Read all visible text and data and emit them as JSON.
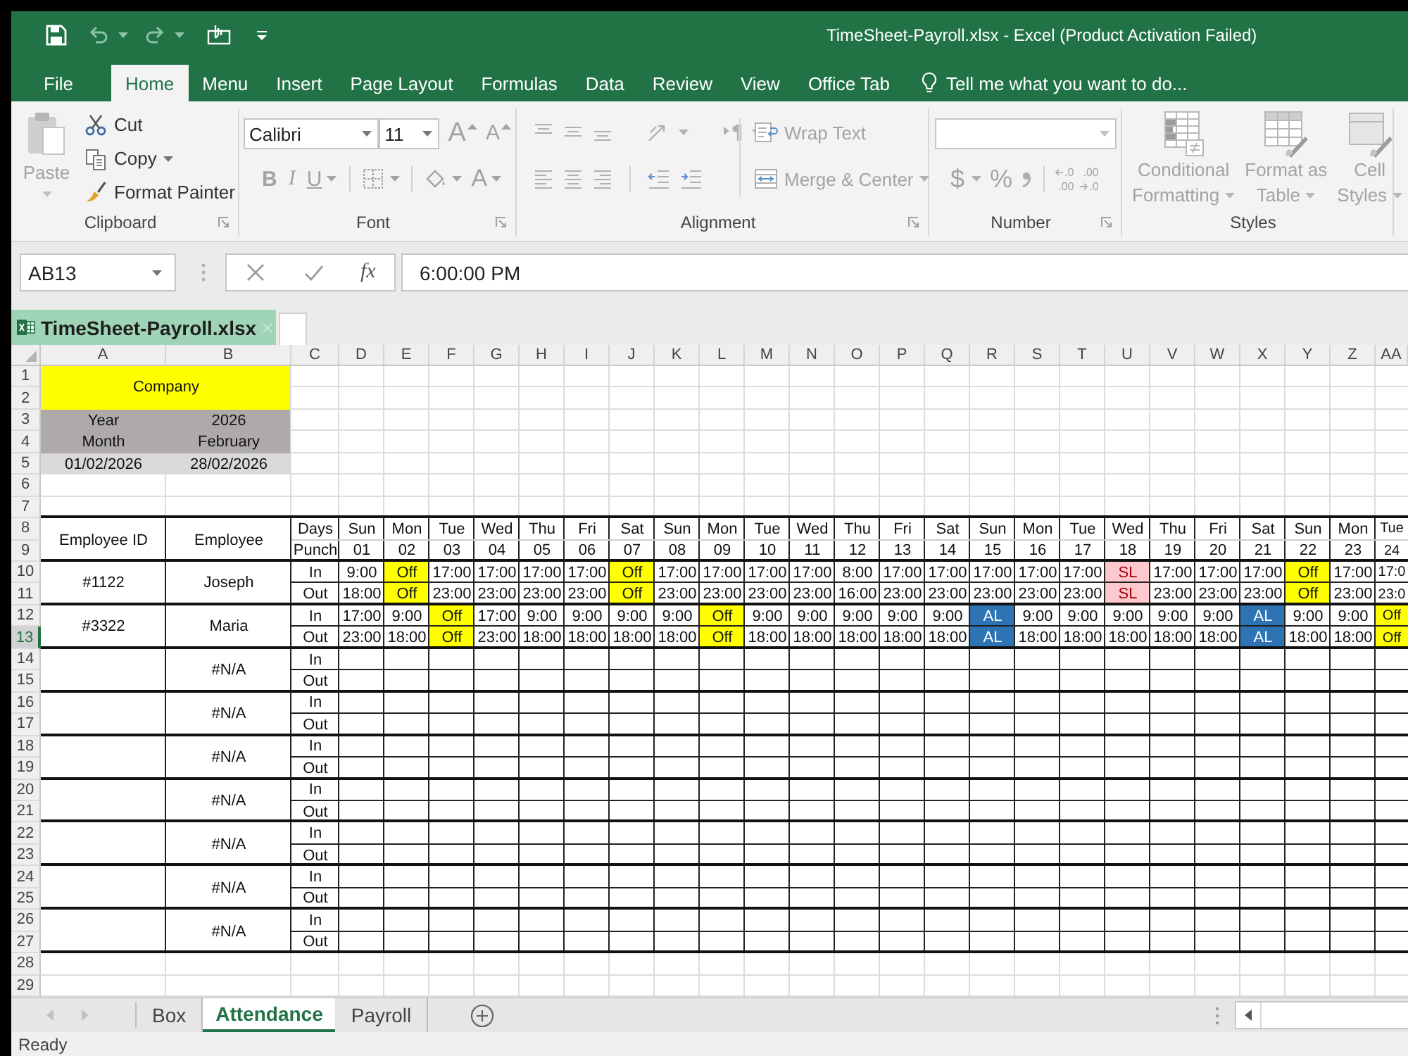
{
  "window": {
    "title": "TimeSheet-Payroll.xlsx - Excel (Product Activation Failed)"
  },
  "menu_tabs": [
    {
      "label": "File",
      "selected": false
    },
    {
      "label": "Home",
      "selected": true
    },
    {
      "label": "Menu",
      "selected": false
    },
    {
      "label": "Insert",
      "selected": false
    },
    {
      "label": "Page Layout",
      "selected": false
    },
    {
      "label": "Formulas",
      "selected": false
    },
    {
      "label": "Data",
      "selected": false
    },
    {
      "label": "Review",
      "selected": false
    },
    {
      "label": "View",
      "selected": false
    },
    {
      "label": "Office Tab",
      "selected": false
    }
  ],
  "tell_me": {
    "placeholder": "Tell me what you want to do..."
  },
  "ribbon": {
    "clipboard": {
      "label": "Clipboard",
      "paste": {
        "label": "Paste",
        "disabled": true
      },
      "actions": [
        {
          "kind": "cut",
          "label": "Cut",
          "disabled": false
        },
        {
          "kind": "copy",
          "label": "Copy",
          "disabled": false
        },
        {
          "kind": "format_painter",
          "label": "Format Painter",
          "disabled": false
        }
      ]
    },
    "font": {
      "label": "Font",
      "font_name": "Calibri",
      "font_size": "11",
      "grow": "A",
      "shrink": "A",
      "styles": [
        {
          "kind": "bold",
          "label": "B"
        },
        {
          "kind": "italic",
          "label": "I"
        },
        {
          "kind": "underline",
          "label": "U"
        }
      ],
      "font_color": "A",
      "disabled": true
    },
    "alignment": {
      "label": "Alignment",
      "wrap_text": "Wrap Text",
      "merge": "Merge & Center",
      "disabled": true
    },
    "number": {
      "label": "Number",
      "currency": "$",
      "percent": "%",
      "decimals": [
        {
          "kind": "increase",
          "lines": [
            ".0",
            ".00"
          ]
        },
        {
          "kind": "decrease",
          "lines": [
            ".00",
            ".0"
          ]
        }
      ],
      "disabled": true
    },
    "styles": {
      "label": "Styles",
      "buttons": [
        {
          "kind": "conditional",
          "lines": [
            "Conditional",
            "Formatting"
          ]
        },
        {
          "kind": "table",
          "lines": [
            "Format as",
            "Table"
          ]
        },
        {
          "kind": "cell",
          "lines": [
            "Cell",
            "Styles"
          ]
        }
      ],
      "disabled": true
    }
  },
  "formula_bar": {
    "name_box": "AB13",
    "function_label": "fx",
    "formula": "6:00:00 PM"
  },
  "document_tab": {
    "title": "TimeSheet-Payroll.xlsx"
  },
  "sheet": {
    "columns": [
      "A",
      "B",
      "C",
      "D",
      "E",
      "F",
      "G",
      "H",
      "I",
      "J",
      "K",
      "L",
      "M",
      "N",
      "O",
      "P",
      "Q",
      "R",
      "S",
      "T",
      "U",
      "V",
      "W",
      "X",
      "Y",
      "Z",
      "AA"
    ],
    "rows": [
      {
        "label": "1",
        "selected": false
      },
      {
        "label": "2",
        "selected": false
      },
      {
        "label": "3",
        "selected": false
      },
      {
        "label": "4",
        "selected": false
      },
      {
        "label": "5",
        "selected": false
      },
      {
        "label": "6",
        "selected": false
      },
      {
        "label": "7",
        "selected": false
      },
      {
        "label": "8",
        "selected": false
      },
      {
        "label": "9",
        "selected": false
      },
      {
        "label": "10",
        "selected": false
      },
      {
        "label": "11",
        "selected": false
      },
      {
        "label": "12",
        "selected": false
      },
      {
        "label": "13",
        "selected": true
      },
      {
        "label": "14",
        "selected": false
      },
      {
        "label": "15",
        "selected": false
      },
      {
        "label": "16",
        "selected": false
      },
      {
        "label": "17",
        "selected": false
      },
      {
        "label": "18",
        "selected": false
      },
      {
        "label": "19",
        "selected": false
      },
      {
        "label": "20",
        "selected": false
      },
      {
        "label": "21",
        "selected": false
      },
      {
        "label": "22",
        "selected": false
      },
      {
        "label": "23",
        "selected": false
      },
      {
        "label": "24",
        "selected": false
      },
      {
        "label": "25",
        "selected": false
      },
      {
        "label": "26",
        "selected": false
      },
      {
        "label": "27",
        "selected": false
      },
      {
        "label": "28",
        "selected": false
      },
      {
        "label": "29",
        "selected": false
      }
    ],
    "company": "Company",
    "period": [
      {
        "label": "Year",
        "value": "2026"
      },
      {
        "label": "Month",
        "value": "February"
      }
    ],
    "date_range": {
      "start": "01/02/2026",
      "end": "28/02/2026"
    },
    "table": {
      "headers": {
        "id": "Employee ID",
        "name": "Employee",
        "days": "Days",
        "punch": "Punch"
      },
      "days": [
        {
          "weekday": "Sun",
          "date": "01"
        },
        {
          "weekday": "Mon",
          "date": "02"
        },
        {
          "weekday": "Tue",
          "date": "03"
        },
        {
          "weekday": "Wed",
          "date": "04"
        },
        {
          "weekday": "Thu",
          "date": "05"
        },
        {
          "weekday": "Fri",
          "date": "06"
        },
        {
          "weekday": "Sat",
          "date": "07"
        },
        {
          "weekday": "Sun",
          "date": "08"
        },
        {
          "weekday": "Mon",
          "date": "09"
        },
        {
          "weekday": "Tue",
          "date": "10"
        },
        {
          "weekday": "Wed",
          "date": "11"
        },
        {
          "weekday": "Thu",
          "date": "12"
        },
        {
          "weekday": "Fri",
          "date": "13"
        },
        {
          "weekday": "Sat",
          "date": "14"
        },
        {
          "weekday": "Sun",
          "date": "15"
        },
        {
          "weekday": "Mon",
          "date": "16"
        },
        {
          "weekday": "Tue",
          "date": "17"
        },
        {
          "weekday": "Wed",
          "date": "18"
        },
        {
          "weekday": "Thu",
          "date": "19"
        },
        {
          "weekday": "Fri",
          "date": "20"
        },
        {
          "weekday": "Sat",
          "date": "21"
        },
        {
          "weekday": "Sun",
          "date": "22"
        },
        {
          "weekday": "Mon",
          "date": "23"
        },
        {
          "weekday": "Tue",
          "date": "24"
        }
      ],
      "employees": [
        {
          "id": "#1122",
          "name": "Joseph",
          "punches": [
            {
              "label": "In",
              "cells": [
                {
                  "text": "9:00",
                  "kind": "time"
                },
                {
                  "text": "Off",
                  "kind": "off"
                },
                {
                  "text": "17:00",
                  "kind": "time"
                },
                {
                  "text": "17:00",
                  "kind": "time"
                },
                {
                  "text": "17:00",
                  "kind": "time"
                },
                {
                  "text": "17:00",
                  "kind": "time"
                },
                {
                  "text": "Off",
                  "kind": "off"
                },
                {
                  "text": "17:00",
                  "kind": "time"
                },
                {
                  "text": "17:00",
                  "kind": "time"
                },
                {
                  "text": "17:00",
                  "kind": "time"
                },
                {
                  "text": "17:00",
                  "kind": "time"
                },
                {
                  "text": "8:00",
                  "kind": "time"
                },
                {
                  "text": "17:00",
                  "kind": "time"
                },
                {
                  "text": "17:00",
                  "kind": "time"
                },
                {
                  "text": "17:00",
                  "kind": "time"
                },
                {
                  "text": "17:00",
                  "kind": "time"
                },
                {
                  "text": "17:00",
                  "kind": "time"
                },
                {
                  "text": "SL",
                  "kind": "sick_leave"
                },
                {
                  "text": "17:00",
                  "kind": "time"
                },
                {
                  "text": "17:00",
                  "kind": "time"
                },
                {
                  "text": "17:00",
                  "kind": "time"
                },
                {
                  "text": "Off",
                  "kind": "off"
                },
                {
                  "text": "17:00",
                  "kind": "time"
                },
                {
                  "text": "17:0",
                  "kind": "time"
                }
              ]
            },
            {
              "label": "Out",
              "cells": [
                {
                  "text": "18:00",
                  "kind": "time"
                },
                {
                  "text": "Off",
                  "kind": "off"
                },
                {
                  "text": "23:00",
                  "kind": "time"
                },
                {
                  "text": "23:00",
                  "kind": "time"
                },
                {
                  "text": "23:00",
                  "kind": "time"
                },
                {
                  "text": "23:00",
                  "kind": "time"
                },
                {
                  "text": "Off",
                  "kind": "off"
                },
                {
                  "text": "23:00",
                  "kind": "time"
                },
                {
                  "text": "23:00",
                  "kind": "time"
                },
                {
                  "text": "23:00",
                  "kind": "time"
                },
                {
                  "text": "23:00",
                  "kind": "time"
                },
                {
                  "text": "16:00",
                  "kind": "time"
                },
                {
                  "text": "23:00",
                  "kind": "time"
                },
                {
                  "text": "23:00",
                  "kind": "time"
                },
                {
                  "text": "23:00",
                  "kind": "time"
                },
                {
                  "text": "23:00",
                  "kind": "time"
                },
                {
                  "text": "23:00",
                  "kind": "time"
                },
                {
                  "text": "SL",
                  "kind": "sick_leave"
                },
                {
                  "text": "23:00",
                  "kind": "time"
                },
                {
                  "text": "23:00",
                  "kind": "time"
                },
                {
                  "text": "23:00",
                  "kind": "time"
                },
                {
                  "text": "Off",
                  "kind": "off"
                },
                {
                  "text": "23:00",
                  "kind": "time"
                },
                {
                  "text": "23:0",
                  "kind": "time"
                }
              ]
            }
          ]
        },
        {
          "id": "#3322",
          "name": "Maria",
          "punches": [
            {
              "label": "In",
              "cells": [
                {
                  "text": "17:00",
                  "kind": "time"
                },
                {
                  "text": "9:00",
                  "kind": "time"
                },
                {
                  "text": "Off",
                  "kind": "off"
                },
                {
                  "text": "17:00",
                  "kind": "time"
                },
                {
                  "text": "9:00",
                  "kind": "time"
                },
                {
                  "text": "9:00",
                  "kind": "time"
                },
                {
                  "text": "9:00",
                  "kind": "time"
                },
                {
                  "text": "9:00",
                  "kind": "time"
                },
                {
                  "text": "Off",
                  "kind": "off"
                },
                {
                  "text": "9:00",
                  "kind": "time"
                },
                {
                  "text": "9:00",
                  "kind": "time"
                },
                {
                  "text": "9:00",
                  "kind": "time"
                },
                {
                  "text": "9:00",
                  "kind": "time"
                },
                {
                  "text": "9:00",
                  "kind": "time"
                },
                {
                  "text": "AL",
                  "kind": "annual_leave"
                },
                {
                  "text": "9:00",
                  "kind": "time"
                },
                {
                  "text": "9:00",
                  "kind": "time"
                },
                {
                  "text": "9:00",
                  "kind": "time"
                },
                {
                  "text": "9:00",
                  "kind": "time"
                },
                {
                  "text": "9:00",
                  "kind": "time"
                },
                {
                  "text": "AL",
                  "kind": "annual_leave"
                },
                {
                  "text": "9:00",
                  "kind": "time"
                },
                {
                  "text": "9:00",
                  "kind": "time"
                },
                {
                  "text": "Off",
                  "kind": "off"
                }
              ]
            },
            {
              "label": "Out",
              "cells": [
                {
                  "text": "23:00",
                  "kind": "time"
                },
                {
                  "text": "18:00",
                  "kind": "time"
                },
                {
                  "text": "Off",
                  "kind": "off"
                },
                {
                  "text": "23:00",
                  "kind": "time"
                },
                {
                  "text": "18:00",
                  "kind": "time"
                },
                {
                  "text": "18:00",
                  "kind": "time"
                },
                {
                  "text": "18:00",
                  "kind": "time"
                },
                {
                  "text": "18:00",
                  "kind": "time"
                },
                {
                  "text": "Off",
                  "kind": "off"
                },
                {
                  "text": "18:00",
                  "kind": "time"
                },
                {
                  "text": "18:00",
                  "kind": "time"
                },
                {
                  "text": "18:00",
                  "kind": "time"
                },
                {
                  "text": "18:00",
                  "kind": "time"
                },
                {
                  "text": "18:00",
                  "kind": "time"
                },
                {
                  "text": "AL",
                  "kind": "annual_leave"
                },
                {
                  "text": "18:00",
                  "kind": "time"
                },
                {
                  "text": "18:00",
                  "kind": "time"
                },
                {
                  "text": "18:00",
                  "kind": "time"
                },
                {
                  "text": "18:00",
                  "kind": "time"
                },
                {
                  "text": "18:00",
                  "kind": "time"
                },
                {
                  "text": "AL",
                  "kind": "annual_leave"
                },
                {
                  "text": "18:00",
                  "kind": "time"
                },
                {
                  "text": "18:00",
                  "kind": "time"
                },
                {
                  "text": "Off",
                  "kind": "off"
                }
              ]
            }
          ]
        },
        {
          "name": "#N/A",
          "punches": [
            {
              "label": "In"
            },
            {
              "label": "Out"
            }
          ]
        },
        {
          "name": "#N/A",
          "punches": [
            {
              "label": "In"
            },
            {
              "label": "Out"
            }
          ]
        },
        {
          "name": "#N/A",
          "punches": [
            {
              "label": "In"
            },
            {
              "label": "Out"
            }
          ]
        },
        {
          "name": "#N/A",
          "punches": [
            {
              "label": "In"
            },
            {
              "label": "Out"
            }
          ]
        },
        {
          "name": "#N/A",
          "punches": [
            {
              "label": "In"
            },
            {
              "label": "Out"
            }
          ]
        },
        {
          "name": "#N/A",
          "punches": [
            {
              "label": "In"
            },
            {
              "label": "Out"
            }
          ]
        },
        {
          "name": "#N/A",
          "punches": [
            {
              "label": "In"
            },
            {
              "label": "Out"
            }
          ]
        }
      ]
    }
  },
  "sheet_tabs": [
    {
      "label": "Box",
      "selected": false
    },
    {
      "label": "Attendance",
      "selected": true
    },
    {
      "label": "Payroll",
      "selected": false
    }
  ],
  "status_bar": {
    "text": "Ready"
  }
}
